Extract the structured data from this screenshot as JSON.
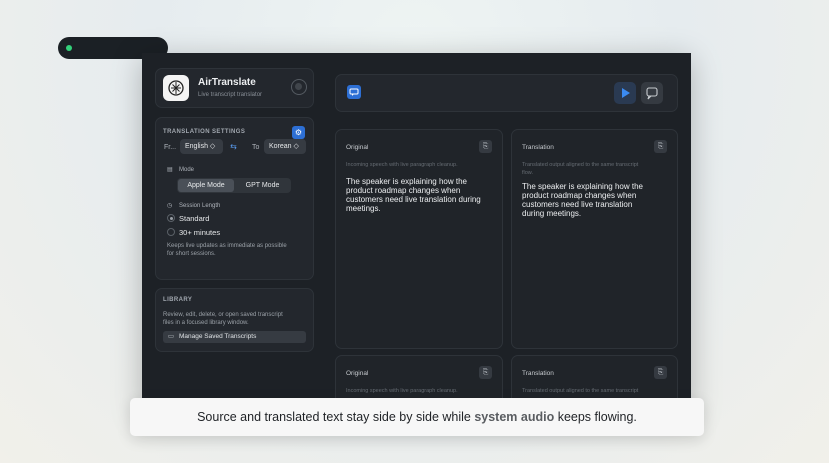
{
  "app": {
    "title": "AirTranslate",
    "subtitle": "Live transcript translator"
  },
  "settings": {
    "heading": "TRANSLATION SETTINGS",
    "from_label": "Fr...",
    "from_value": "English ◇",
    "to_label": "To",
    "to_value": "Korean ◇",
    "mode_label": "Mode",
    "mode_options": [
      "Apple Mode",
      "GPT Mode"
    ],
    "mode_selected": "Apple Mode",
    "session_label": "Session Length",
    "session_options": [
      "Standard",
      "30+ minutes"
    ],
    "session_selected": "Standard",
    "note_line1": "Keeps live updates as immediate as possible",
    "note_line2": "for short sessions."
  },
  "library": {
    "heading": "LIBRARY",
    "desc_line1": "Review, edit, delete, or open saved transcript",
    "desc_line2": "files in a focused library window.",
    "button": "Manage Saved Transcripts"
  },
  "panels": [
    {
      "title": "Original",
      "sub": "Incoming speech with live paragraph cleanup.",
      "text": [
        "The speaker is explaining how the",
        "product roadmap changes when",
        "customers need live translation during",
        "meetings."
      ]
    },
    {
      "title": "Translation",
      "sub": "Translated output aligned to the same transcript",
      "sub2": "flow.",
      "text": [
        "The speaker is explaining how the",
        "product roadmap changes when",
        "customers need live translation",
        "during meetings."
      ]
    },
    {
      "title": "Original",
      "sub": "Incoming speech with live paragraph cleanup."
    },
    {
      "title": "Translation",
      "sub": "Translated output aligned to the same transcript"
    }
  ],
  "caption": {
    "before": "Source and translated text stay side by side while ",
    "bold": "system audio",
    "after": " keeps flowing."
  },
  "colors": {
    "accent": "#2d6fd4",
    "status_dot": "#33d17a",
    "window_bg": "#1d2126"
  }
}
